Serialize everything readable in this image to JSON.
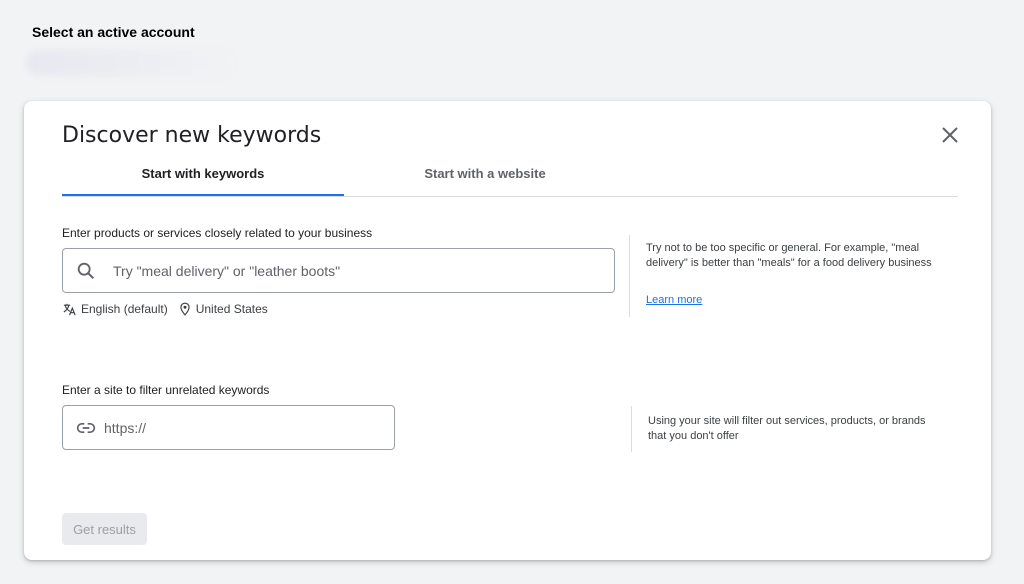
{
  "account": {
    "label": "Select an active account"
  },
  "dialog": {
    "title": "Discover new keywords",
    "tabs": [
      {
        "label": "Start with keywords",
        "active": true
      },
      {
        "label": "Start with a website",
        "active": false
      }
    ],
    "keywords": {
      "label": "Enter products or services closely related to your business",
      "placeholder": "Try \"meal delivery\" or \"leather boots\"",
      "language": "English (default)",
      "location": "United States",
      "help": "Try not to be too specific or general. For example, \"meal delivery\" is better than \"meals\" for a food delivery business",
      "learn_more": "Learn more"
    },
    "site": {
      "label": "Enter a site to filter unrelated keywords",
      "placeholder": "https://",
      "help": "Using your site will filter out services, products, or brands that you don't offer"
    },
    "submit_label": "Get results"
  },
  "colors": {
    "accent": "#1a73e8",
    "page_bg": "#f1f3f4",
    "disabled_button_bg": "#e8eaed"
  }
}
